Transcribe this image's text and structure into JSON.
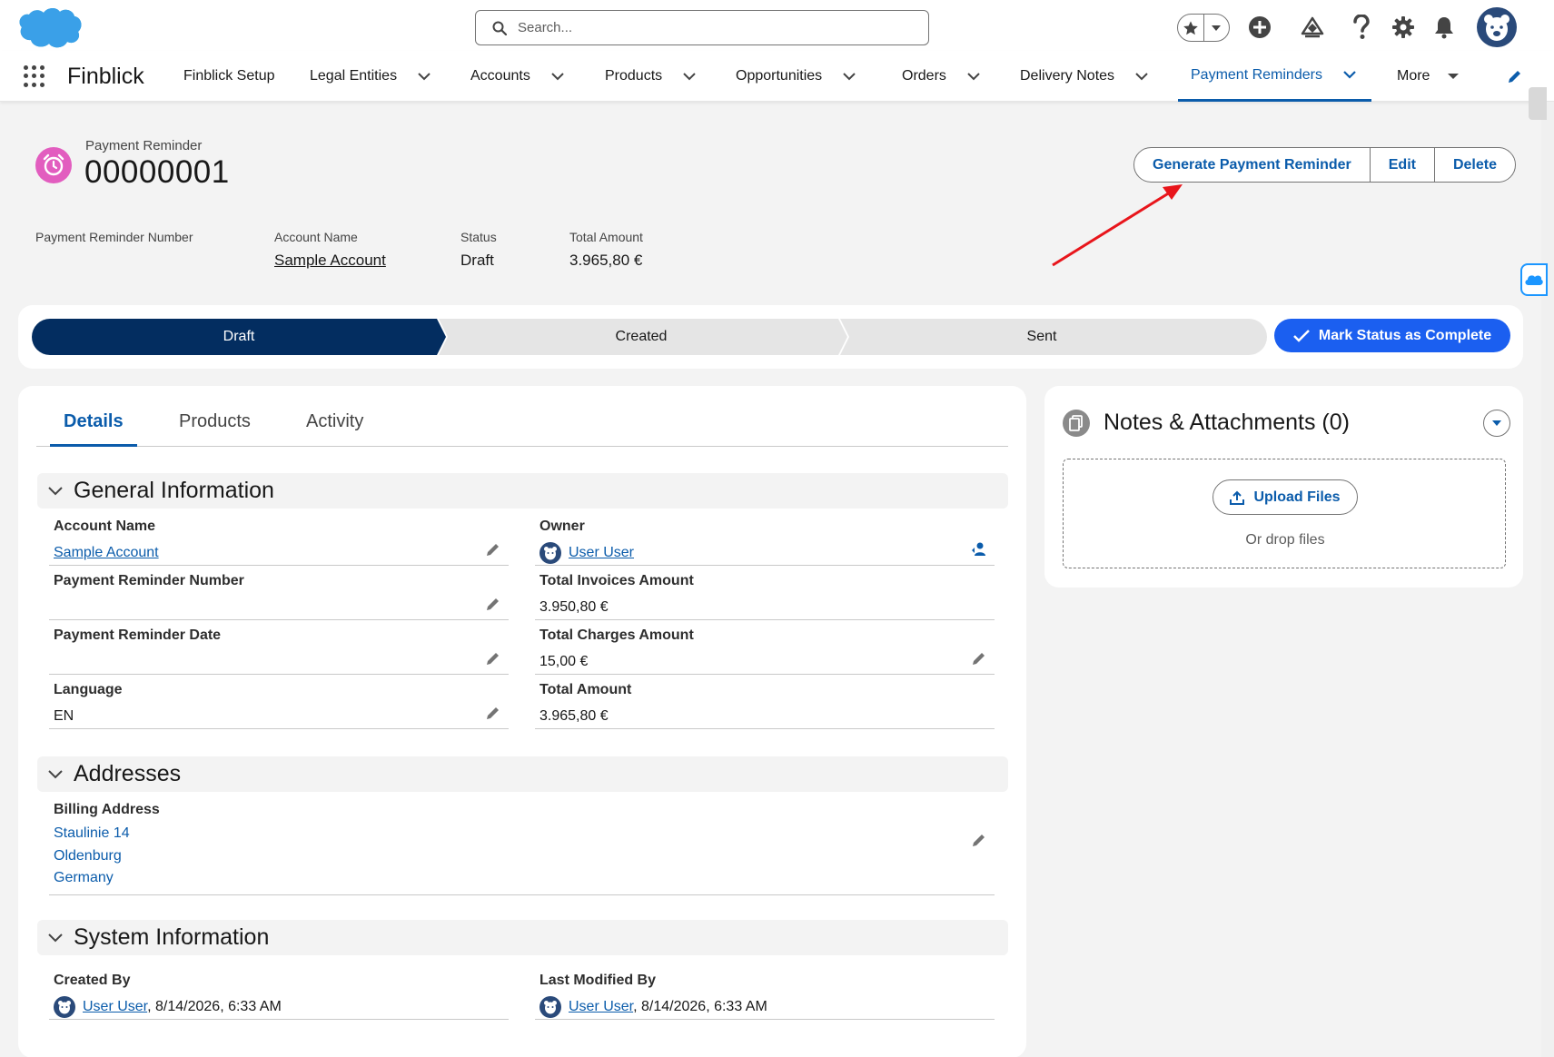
{
  "header": {
    "search_placeholder": "Search..."
  },
  "nav": {
    "app_name": "Finblick",
    "items": [
      {
        "label": "Finblick Setup"
      },
      {
        "label": "Legal Entities"
      },
      {
        "label": "Accounts"
      },
      {
        "label": "Products"
      },
      {
        "label": "Opportunities"
      },
      {
        "label": "Orders"
      },
      {
        "label": "Delivery Notes"
      },
      {
        "label": "Payment Reminders"
      },
      {
        "label": "More"
      }
    ]
  },
  "record": {
    "type": "Payment Reminder",
    "title": "00000001",
    "actions": {
      "generate": "Generate Payment Reminder",
      "edit": "Edit",
      "delete": "Delete"
    },
    "highlights": [
      {
        "label": "Payment Reminder Number",
        "value": ""
      },
      {
        "label": "Account Name",
        "value": "Sample Account"
      },
      {
        "label": "Status",
        "value": "Draft"
      },
      {
        "label": "Total Amount",
        "value": "3.965,80 €"
      }
    ]
  },
  "path": {
    "steps": [
      "Draft",
      "Created",
      "Sent"
    ],
    "current": "Draft",
    "complete_button": "Mark Status as Complete"
  },
  "tabs": [
    "Details",
    "Products",
    "Activity"
  ],
  "sections": {
    "general": {
      "title": "General Information",
      "account_name_label": "Account Name",
      "account_name_value": "Sample Account",
      "owner_label": "Owner",
      "owner_value": "User User",
      "prn_label": "Payment Reminder Number",
      "prn_value": "",
      "tia_label": "Total Invoices Amount",
      "tia_value": "3.950,80 €",
      "prd_label": "Payment Reminder Date",
      "prd_value": "",
      "tca_label": "Total Charges Amount",
      "tca_value": "15,00 €",
      "lang_label": "Language",
      "lang_value": "EN",
      "ta_label": "Total Amount",
      "ta_value": "3.965,80 €"
    },
    "addresses": {
      "title": "Addresses",
      "billing_label": "Billing Address",
      "billing_lines": [
        "Staulinie 14",
        "Oldenburg",
        "Germany"
      ]
    },
    "system": {
      "title": "System Information",
      "created_by_label": "Created By",
      "created_by_user": "User User",
      "created_by_date": ", 8/14/2026, 6:33 AM",
      "modified_by_label": "Last Modified By",
      "modified_by_user": "User User",
      "modified_by_date": ", 8/14/2026, 6:33 AM"
    }
  },
  "notes": {
    "title": "Notes & Attachments (0)",
    "upload_button": "Upload Files",
    "drop_text": "Or drop files"
  },
  "colors": {
    "brand_blue": "#0b5cab",
    "path_active": "#032d60",
    "complete_button": "#1b5ff0",
    "record_icon": "#e25dbf",
    "annotation_arrow": "#e8151b"
  }
}
